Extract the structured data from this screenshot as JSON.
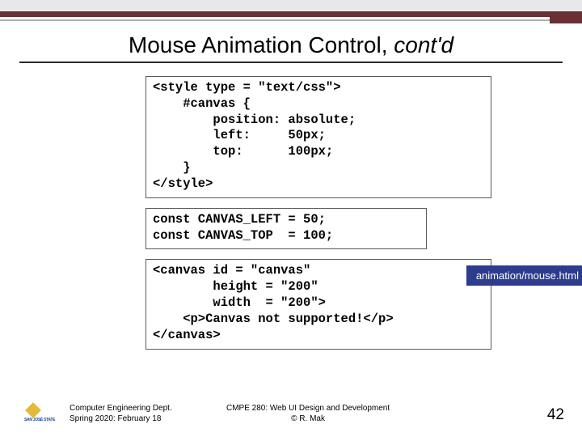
{
  "title_main": "Mouse Animation Control, ",
  "title_italic": "cont'd",
  "code1": "<style type = \"text/css\">\n    #canvas {\n        position: absolute;\n        left:     50px;\n        top:      100px;\n    }\n</style>",
  "code2": "const CANVAS_LEFT = 50;\nconst CANVAS_TOP  = 100;",
  "file_label": "animation/mouse.html",
  "code3": "<canvas id = \"canvas\"\n        height = \"200\"\n        width  = \"200\">\n    <p>Canvas not supported!</p>\n</canvas>",
  "footer": {
    "dept_line1": "Computer Engineering Dept.",
    "dept_line2": "Spring 2020: February 18",
    "course_line1": "CMPE 280: Web UI Design and Development",
    "course_line2": "© R. Mak",
    "logo_text": "SAN JOSÉ STATE",
    "page": "42"
  }
}
